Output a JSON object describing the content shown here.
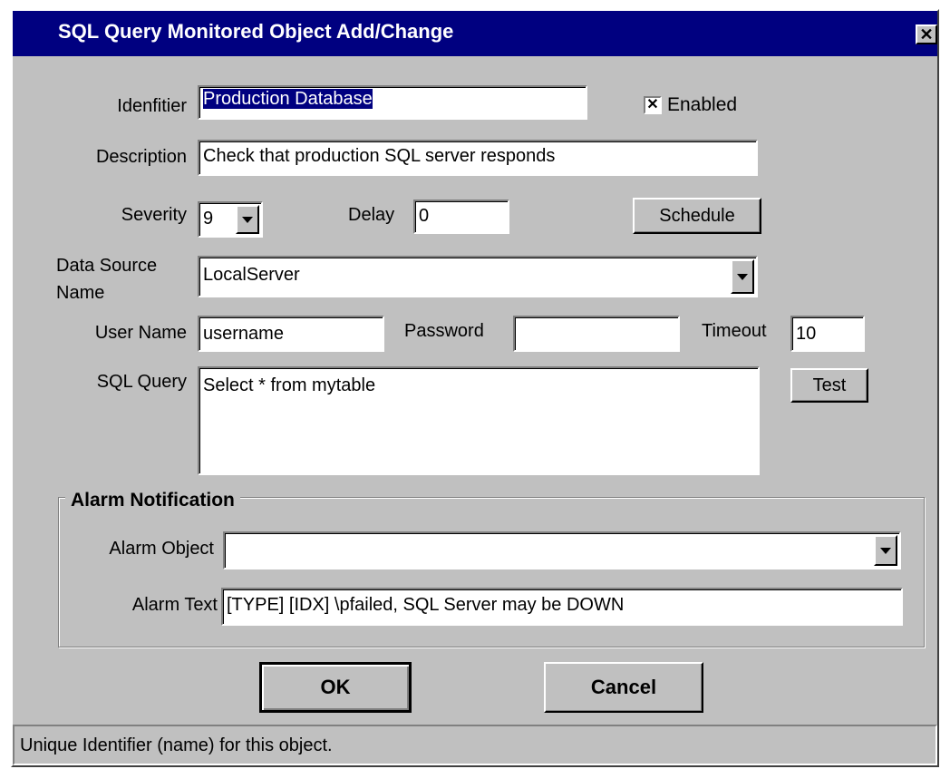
{
  "window": {
    "title": "SQL Query Monitored Object Add/Change",
    "close_glyph": "✕"
  },
  "form": {
    "identifier": {
      "label": "Idenfitier",
      "value": "Production Database"
    },
    "enabled": {
      "label": "Enabled",
      "checked": true,
      "glyph": "✕"
    },
    "description": {
      "label": "Description",
      "value": "Check that production SQL server responds"
    },
    "severity": {
      "label": "Severity",
      "value": "9"
    },
    "delay": {
      "label": "Delay",
      "value": "0"
    },
    "schedule_button": "Schedule",
    "data_source": {
      "label_line1": "Data Source",
      "label_line2": "Name",
      "value": "LocalServer"
    },
    "user_name": {
      "label": "User Name",
      "value": "username"
    },
    "password": {
      "label": "Password",
      "value": ""
    },
    "timeout": {
      "label": "Timeout",
      "value": "10"
    },
    "sql_query": {
      "label": "SQL Query",
      "value": "Select * from mytable"
    },
    "test_button": "Test"
  },
  "alarm": {
    "group_title": "Alarm Notification",
    "object": {
      "label": "Alarm Object",
      "value": ""
    },
    "text": {
      "label": "Alarm Text",
      "value": "[TYPE] [IDX] \\pfailed, SQL Server may be DOWN"
    }
  },
  "buttons": {
    "ok": "OK",
    "cancel": "Cancel"
  },
  "status_bar": "Unique Identifier (name) for this object.",
  "colors": {
    "titlebar": "#000080",
    "dialog": "#c0c0c0",
    "selection": "#000080"
  },
  "icons": {
    "close": "close-icon",
    "dropdown": "chevron-down-icon",
    "checkbox": "checkbox-checked-icon"
  }
}
